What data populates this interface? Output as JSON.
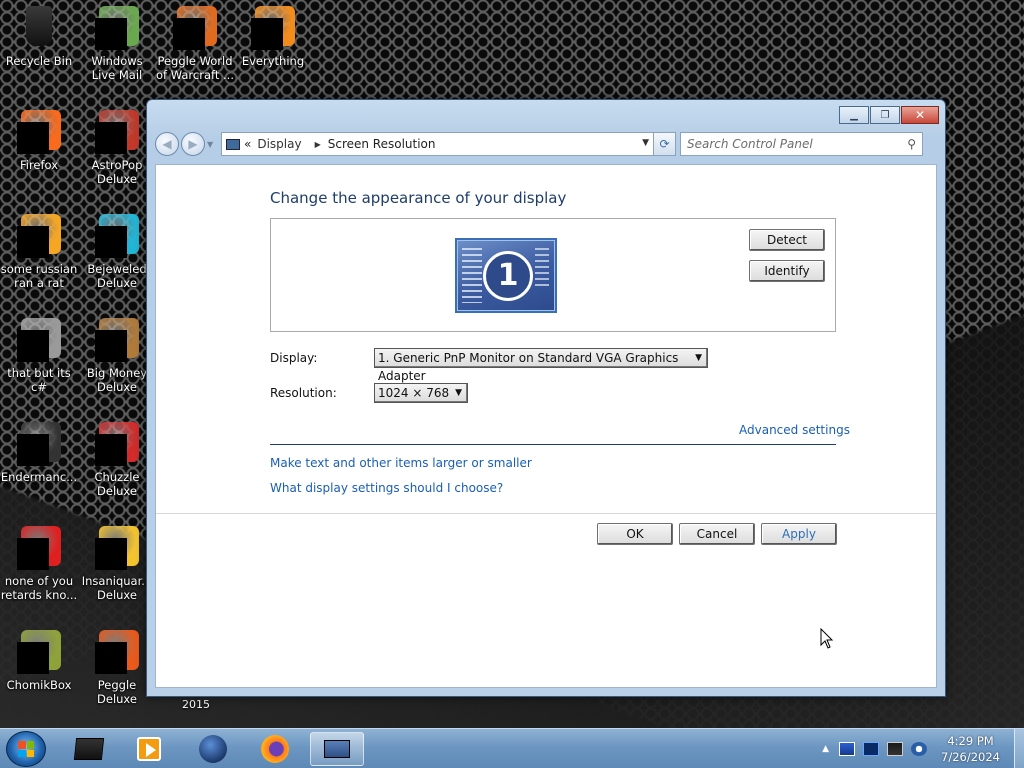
{
  "desktop": {
    "icons": [
      {
        "label": "Recycle Bin",
        "icon": "recycle-bin-icon",
        "color": "#222222"
      },
      {
        "label": "Windows Live Mail",
        "icon": "mail-icon",
        "color": "#6aa84f"
      },
      {
        "label": "Peggle World of Warcraft ...",
        "icon": "peggle-wow-icon",
        "color": "#e06b1f"
      },
      {
        "label": "Everything",
        "icon": "magnifier-icon",
        "color": "#f28c1c"
      },
      {
        "label": "Firefox",
        "icon": "firefox-icon",
        "color": "#f86a1c"
      },
      {
        "label": "AstroPop Deluxe",
        "icon": "astropop-icon",
        "color": "#c0392b"
      },
      {
        "label": "some russian ran a rat",
        "icon": "folder-e-icon",
        "color": "#f5a623"
      },
      {
        "label": "Bejeweled Deluxe",
        "icon": "bejeweled-icon",
        "color": "#22b5d6"
      },
      {
        "label": "that but its c#",
        "icon": "stack-icon",
        "color": "#9a9a9a"
      },
      {
        "label": "Big Money Deluxe",
        "icon": "big-money-icon",
        "color": "#b07a3a"
      },
      {
        "label": "Endermanc...",
        "icon": "window-app-icon",
        "color": "#333333"
      },
      {
        "label": "Chuzzle Deluxe",
        "icon": "chuzzle-icon",
        "color": "#d12b2b"
      },
      {
        "label": "none of you retards kno...",
        "icon": "opera-icon",
        "color": "#e02020"
      },
      {
        "label": "Insaniquar... Deluxe",
        "icon": "insaniquarium-icon",
        "color": "#f4c430"
      },
      {
        "label": "ChomikBox",
        "icon": "chomikbox-icon",
        "color": "#8fa23a"
      },
      {
        "label": "Peggle Deluxe",
        "icon": "peggle-icon",
        "color": "#e85a1c"
      }
    ],
    "extra_text": "2015"
  },
  "window": {
    "address": {
      "prefix": "«",
      "crumb1": "Display",
      "crumb2": "Screen Resolution"
    },
    "search_placeholder": "Search Control Panel",
    "heading": "Change the appearance of your display",
    "monitor_number": "1",
    "detect_label": "Detect",
    "identify_label": "Identify",
    "display_label": "Display:",
    "display_value": "1. Generic PnP Monitor on Standard VGA Graphics Adapter",
    "resolution_label": "Resolution:",
    "resolution_value": "1024 × 768",
    "advanced_link": "Advanced settings",
    "link1": "Make text and other items larger or smaller",
    "link2": "What display settings should I choose?",
    "ok_label": "OK",
    "cancel_label": "Cancel",
    "apply_label": "Apply"
  },
  "taskbar": {
    "apps": [
      "monitor-app-icon",
      "media-player-icon",
      "world-icon",
      "firefox-icon",
      "display-settings-icon"
    ],
    "time": "4:29 PM",
    "date": "7/26/2024"
  },
  "colors": {
    "accent_link": "#1a5fb4",
    "heading": "#1e3d6b"
  }
}
